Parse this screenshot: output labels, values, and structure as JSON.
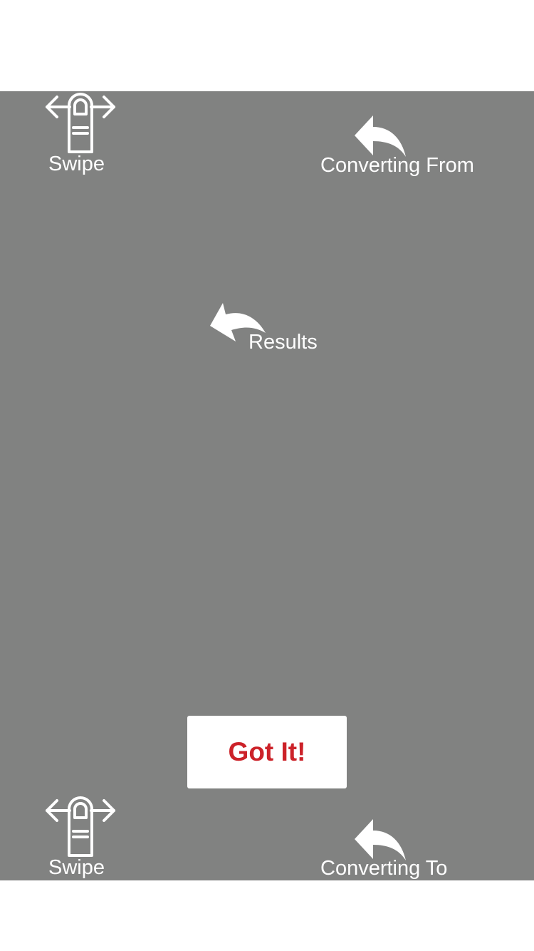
{
  "tutorial": {
    "swipe_top_label": "Swipe",
    "converting_from_label": "Converting From",
    "results_label": "Results",
    "got_it_label": "Got It!",
    "swipe_bottom_label": "Swipe",
    "converting_to_label": "Converting To"
  },
  "icons": {
    "swipe": "swipe-gesture-icon",
    "arrow": "curved-arrow-icon"
  },
  "colors": {
    "overlay": "#818281",
    "button_text": "#cc2229",
    "label": "#ffffff"
  }
}
